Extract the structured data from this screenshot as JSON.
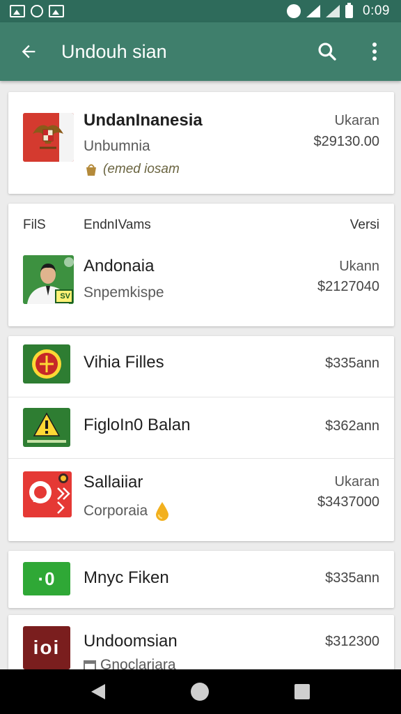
{
  "status_bar": {
    "time": "0:09",
    "icons": [
      "picture-icon",
      "message-icon",
      "image-icon",
      "alarm-icon",
      "wifi-signal-icon",
      "cell-signal-icon",
      "battery-icon"
    ]
  },
  "app_bar": {
    "title": "Undouh sian",
    "icons": [
      "back-arrow-icon",
      "search-icon",
      "more-vert-icon"
    ]
  },
  "cards": [
    {
      "rows": [
        {
          "title": "UndanInanesia",
          "subtitle": "Unbumnia",
          "tag": "(emed iosam",
          "right_label": "Ukaran",
          "price": "$29130.00",
          "icon": "garuda-emblem-icon",
          "tag_icon": "bag-icon"
        }
      ]
    },
    {
      "header": {
        "col1": "FilS",
        "col2": "EndnIVams",
        "col3": "Versi"
      },
      "rows": [
        {
          "title": "Andonaia",
          "subtitle": "Snpemkispe",
          "right_label": "Ukann",
          "price": "$2127040",
          "icon": "portrait-photo-icon",
          "badge": "SV"
        }
      ]
    },
    {
      "rows": [
        {
          "title": "Vihia Filles",
          "price": "$335ann",
          "icon": "green-emblem-icon"
        },
        {
          "title": "FigloIn0 Balan",
          "price": "$362ann",
          "icon": "warning-icon"
        },
        {
          "title": "Sallaiiar",
          "subtitle": "Corporaia",
          "right_label": "Ukaran",
          "price": "$3437000",
          "icon": "red-pattern-icon",
          "tag_icon": "drop-icon"
        }
      ]
    },
    {
      "rows": [
        {
          "title": "Mnyc Fiken",
          "price": "$335ann",
          "icon": "green-logo-icon",
          "logo_text": "·0"
        }
      ]
    },
    {
      "rows": [
        {
          "title": "Undoomsian",
          "subtitle": "Gnoclariara",
          "price": "$312300",
          "icon": "dark-red-logo-icon",
          "logo_text": "ioi",
          "tag_icon": "calendar-icon"
        }
      ]
    }
  ],
  "colors": {
    "status_bar": "#2e6b5b",
    "app_bar": "#3f7f6c",
    "background": "#ececec",
    "card": "#ffffff"
  },
  "nav_bar": {
    "icons": [
      "nav-back-icon",
      "nav-home-icon",
      "nav-recent-icon"
    ]
  }
}
